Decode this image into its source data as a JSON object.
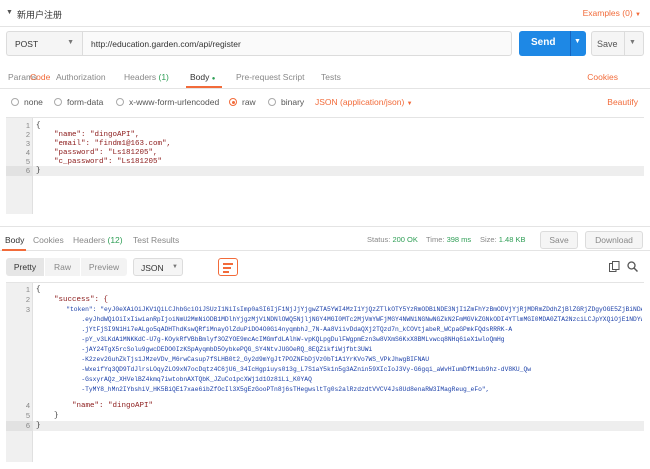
{
  "title_bar": {
    "caret": "▼",
    "title": "新用户注册",
    "examples": "Examples (0)",
    "examples_chevron": "▼"
  },
  "request": {
    "method": "POST",
    "url": "http://education.garden.com/api/register",
    "send_label": "Send",
    "save_label": "Save"
  },
  "request_tabs": [
    {
      "label": "Params",
      "count": ""
    },
    {
      "label": "Authorization",
      "count": ""
    },
    {
      "label": "Headers ",
      "count": "(1)"
    },
    {
      "label": "Body",
      "count": "●"
    },
    {
      "label": "Pre-request Script",
      "count": ""
    },
    {
      "label": "Tests",
      "count": ""
    }
  ],
  "request_tabs_right": {
    "cookies": "Cookies",
    "code": "Code"
  },
  "body_types": [
    {
      "label": "none",
      "selected": false
    },
    {
      "label": "form-data",
      "selected": false
    },
    {
      "label": "x-www-form-urlencoded",
      "selected": false
    },
    {
      "label": "raw",
      "selected": true
    },
    {
      "label": "binary",
      "selected": false
    }
  ],
  "content_type": "JSON (application/json)",
  "beautify": "Beautify",
  "request_body": {
    "line_numbers": [
      "1",
      "2",
      "3",
      "4",
      "5",
      "6"
    ],
    "lines": [
      "{",
      "    \"name\": \"dingoAPI\",",
      "    \"email\": \"findm1@163.com\",",
      "    \"password\": \"Ls181205\",",
      "    \"c_password\": \"Ls181205\"",
      "}"
    ]
  },
  "response_tabs": [
    {
      "label": "Body",
      "count": ""
    },
    {
      "label": "Cookies",
      "count": ""
    },
    {
      "label": "Headers ",
      "count": "(12)"
    },
    {
      "label": "Test Results",
      "count": ""
    }
  ],
  "response_status": {
    "status_label": "Status:",
    "status_value": "200 OK",
    "time_label": "Time:",
    "time_value": "398 ms",
    "size_label": "Size:",
    "size_value": "1.48 KB"
  },
  "response_buttons": {
    "save": "Save",
    "download": "Download"
  },
  "view_modes": [
    {
      "label": "Pretty",
      "selected": true
    },
    {
      "label": "Raw",
      "selected": false
    },
    {
      "label": "Preview",
      "selected": false
    }
  ],
  "response_format": "JSON",
  "response_body": {
    "line_numbers": [
      "1",
      "2",
      "3",
      "4",
      "5",
      "6"
    ],
    "lines": [
      "{",
      "    \"success\": {",
      "        \"token\": \"eyJ0eXAiOiJKV1QiLCJhbGciOiJSUzI1NiIsImp0aSI6IjF1NjJjYjgwZTA5YWI4MzI1YjQzZTlkOTY5YzRmODBiNDE3NjI1ZmFhYzBmODVjYjRjMDRmZDdhZjBlZGRjZDgyOGE5ZjBiNDAwNGUwNjc3In0",
      "            .eyJhdWQiOiIxIiwianRpIjoiNmU2MmNiODB1MDlhYjgzMjViNDNlOWQ5NjljNGY4MGI0MTc2MjVmYWFjMGY4NWNiNGNwNGZkN2FmMGVkZGNkODI4YTlmMGI0MDA0ZTA2NzciLCJpYXQiOjE1NDYwNDkwNDksIm5iZiI6MTU0NjA0OTA0OSwiZXhwIjoxNTc3NTg1MDA1LCJzdWIiOiIxIiwic2NvcGVzIjpbXX0",
      "            .jYtFjSI9N1Hi7eALgo5qADHThdKswQRfiMnayOlZduPiDO4O0Gi4nyqmbhJ_7N-Aa8ViivDdaQXj2TQzd7n_kCOVtjabeR_WCpaGPmkFQdsRRRK-A",
      "            -pY_v3LKdA1MNKKdC-U7g-KOykRfVBbBmlyf3OZYOE9mcAcIMGmfdLAlhW-vpKQLpgDulFWgpmEzn3w8VXmS6KxX8BMLvwcq8NHq6ieX1wloQmHg",
      "            -jAY24TgX5rcSolu9gwcDEDO0IzKSpAyqmbD5OybkePQG_SY4NtvJUGOeRQ_8EQZikfiWjfbt3UWi",
      "            -K2zev2GuhZkTjs1JMzeVDv_M6rwCasup7fSLHB0t2_Gy2d9mYgJt7POZNFbDjVz0bT1A1YrKVo7WS_VPkJhwgBIFNAU",
      "            -WxeifYq3QD9TdJlrsLOqyZLO9xN7ocDqtz4C6jU6_34IcHgpiuys013g_L7S1aY5k1n5g3AZnin59XIcIoJ3Vy-G6gqi_aWvHIumDfM1ub9hz-dV8KU_Qw",
      "            -GsxyrAQz_XHVelBZ4kmq7iwtobnAXTQbK_JZuCo1pcXWj1d1Oz81Li_K0YAQ",
      "            -TyMY8_hMn2IYbshiV_HK5BiQE17xae6ibZfOcIl3X5gEzGooPTn8j6sTHegwsltTg0s2alRzdzdtVVCV4Js8Ud8enaRW3IMagReug_eFo\",",
      "        \"name\": \"dingoAPI\"",
      "    }",
      "}"
    ]
  }
}
